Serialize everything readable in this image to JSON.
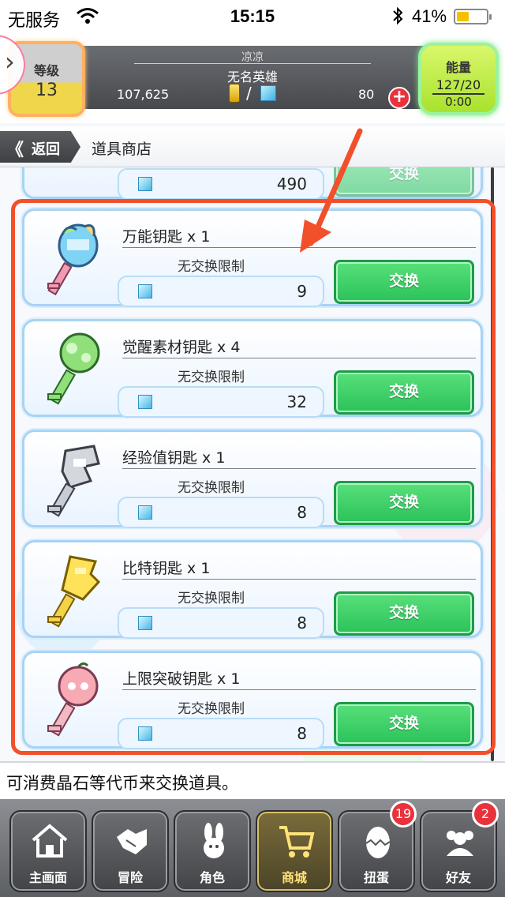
{
  "status_bar": {
    "carrier": "无服务",
    "time": "15:15",
    "battery_percent": "41%",
    "battery_level": 0.41
  },
  "header": {
    "level_label": "等级",
    "level_value": "13",
    "player_name": "凉凉",
    "player_title": "无名英雄",
    "coins": "107,625",
    "slash": "/",
    "crystals": "80",
    "energy_label": "能量",
    "energy_value": "127/20",
    "energy_timer": "0:00",
    "add_symbol": "+"
  },
  "nav": {
    "back_label": "返回",
    "back_arrows": "《",
    "page_title": "道具商店"
  },
  "items": [
    {
      "name": "",
      "limit": "",
      "price": "490",
      "button": "交换"
    },
    {
      "name": "万能钥匙 x 1",
      "limit": "无交换限制",
      "price": "9",
      "button": "交换"
    },
    {
      "name": "觉醒素材钥匙 x 4",
      "limit": "无交换限制",
      "price": "32",
      "button": "交换"
    },
    {
      "name": "经验值钥匙 x 1",
      "limit": "无交换限制",
      "price": "8",
      "button": "交换"
    },
    {
      "name": "比特钥匙 x 1",
      "limit": "无交换限制",
      "price": "8",
      "button": "交换"
    },
    {
      "name": "上限突破钥匙 x 1",
      "limit": "无交换限制",
      "price": "8",
      "button": "交换"
    }
  ],
  "message": "可消费晶石等代币来交换道具。",
  "tabs": [
    {
      "label": "主画面",
      "icon": "home-icon",
      "badge": ""
    },
    {
      "label": "冒险",
      "icon": "handshake-icon",
      "badge": ""
    },
    {
      "label": "角色",
      "icon": "rabbit-icon",
      "badge": ""
    },
    {
      "label": "商城",
      "icon": "cart-icon",
      "badge": "",
      "active": true
    },
    {
      "label": "扭蛋",
      "icon": "egg-icon",
      "badge": "19"
    },
    {
      "label": "好友",
      "icon": "friends-icon",
      "badge": "2"
    }
  ],
  "colors": {
    "exchange_button": "#2bc25a",
    "highlight": "#f2502a",
    "badge": "#e8323c"
  }
}
